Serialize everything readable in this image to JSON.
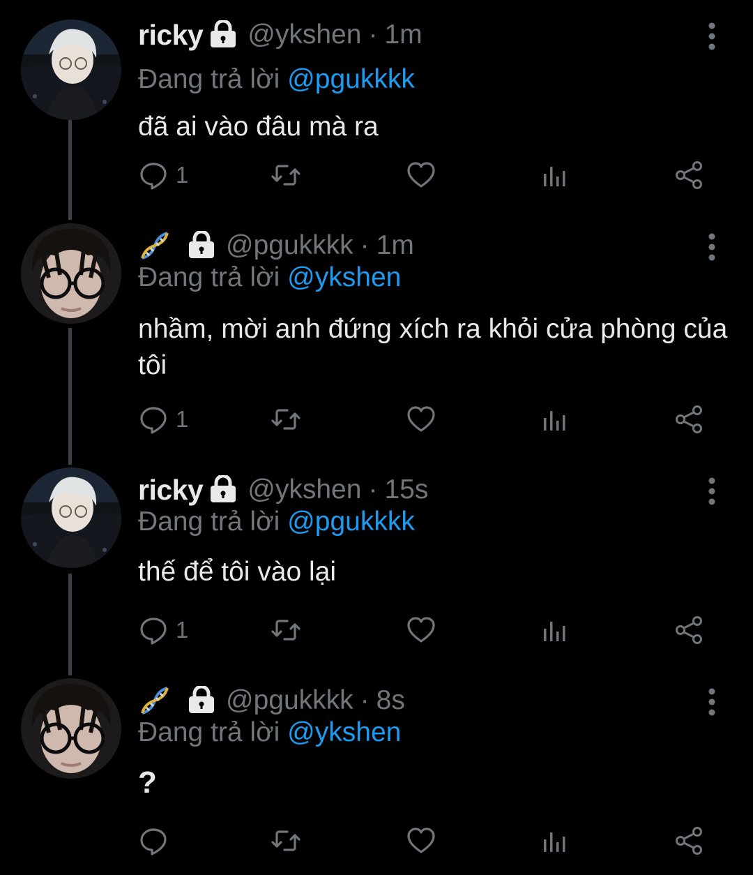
{
  "reply_prefix": "Đang trả lời",
  "tweets": [
    {
      "display_name": "ricky",
      "handle": "@ykshen",
      "separator": "·",
      "time": "1m",
      "reply_to": "@pgukkkk",
      "text": "đã ai vào đâu mà ra",
      "reply_count": "1",
      "avatar": "ricky-avatar",
      "has_dna_emoji": false
    },
    {
      "display_name": "",
      "handle": "@pgukkkk",
      "separator": "·",
      "time": "1m",
      "reply_to": "@ykshen",
      "text": "nhầm, mời anh đứng xích ra khỏi cửa phòng của tôi",
      "reply_count": "1",
      "avatar": "pgukkkk-avatar",
      "has_dna_emoji": true
    },
    {
      "display_name": "ricky",
      "handle": "@ykshen",
      "separator": "·",
      "time": "15s",
      "reply_to": "@pgukkkk",
      "text": "thế để tôi vào lại",
      "reply_count": "1",
      "avatar": "ricky-avatar",
      "has_dna_emoji": false
    },
    {
      "display_name": "",
      "handle": "@pgukkkk",
      "separator": "·",
      "time": "8s",
      "reply_to": "@ykshen",
      "text": "?",
      "reply_count": "",
      "avatar": "pgukkkk-avatar",
      "has_dna_emoji": true
    }
  ],
  "icons": {
    "lock": "lock-icon",
    "dna": "dna-emoji-icon",
    "more": "more-vertical-icon",
    "reply": "reply-icon",
    "retweet": "retweet-icon",
    "like": "heart-icon",
    "analytics": "analytics-icon",
    "share": "share-icon"
  },
  "colors": {
    "background": "#000000",
    "text": "#e7e9ea",
    "muted": "#71767b",
    "mention": "#1d9bf0",
    "thread_line": "#3a4046"
  }
}
